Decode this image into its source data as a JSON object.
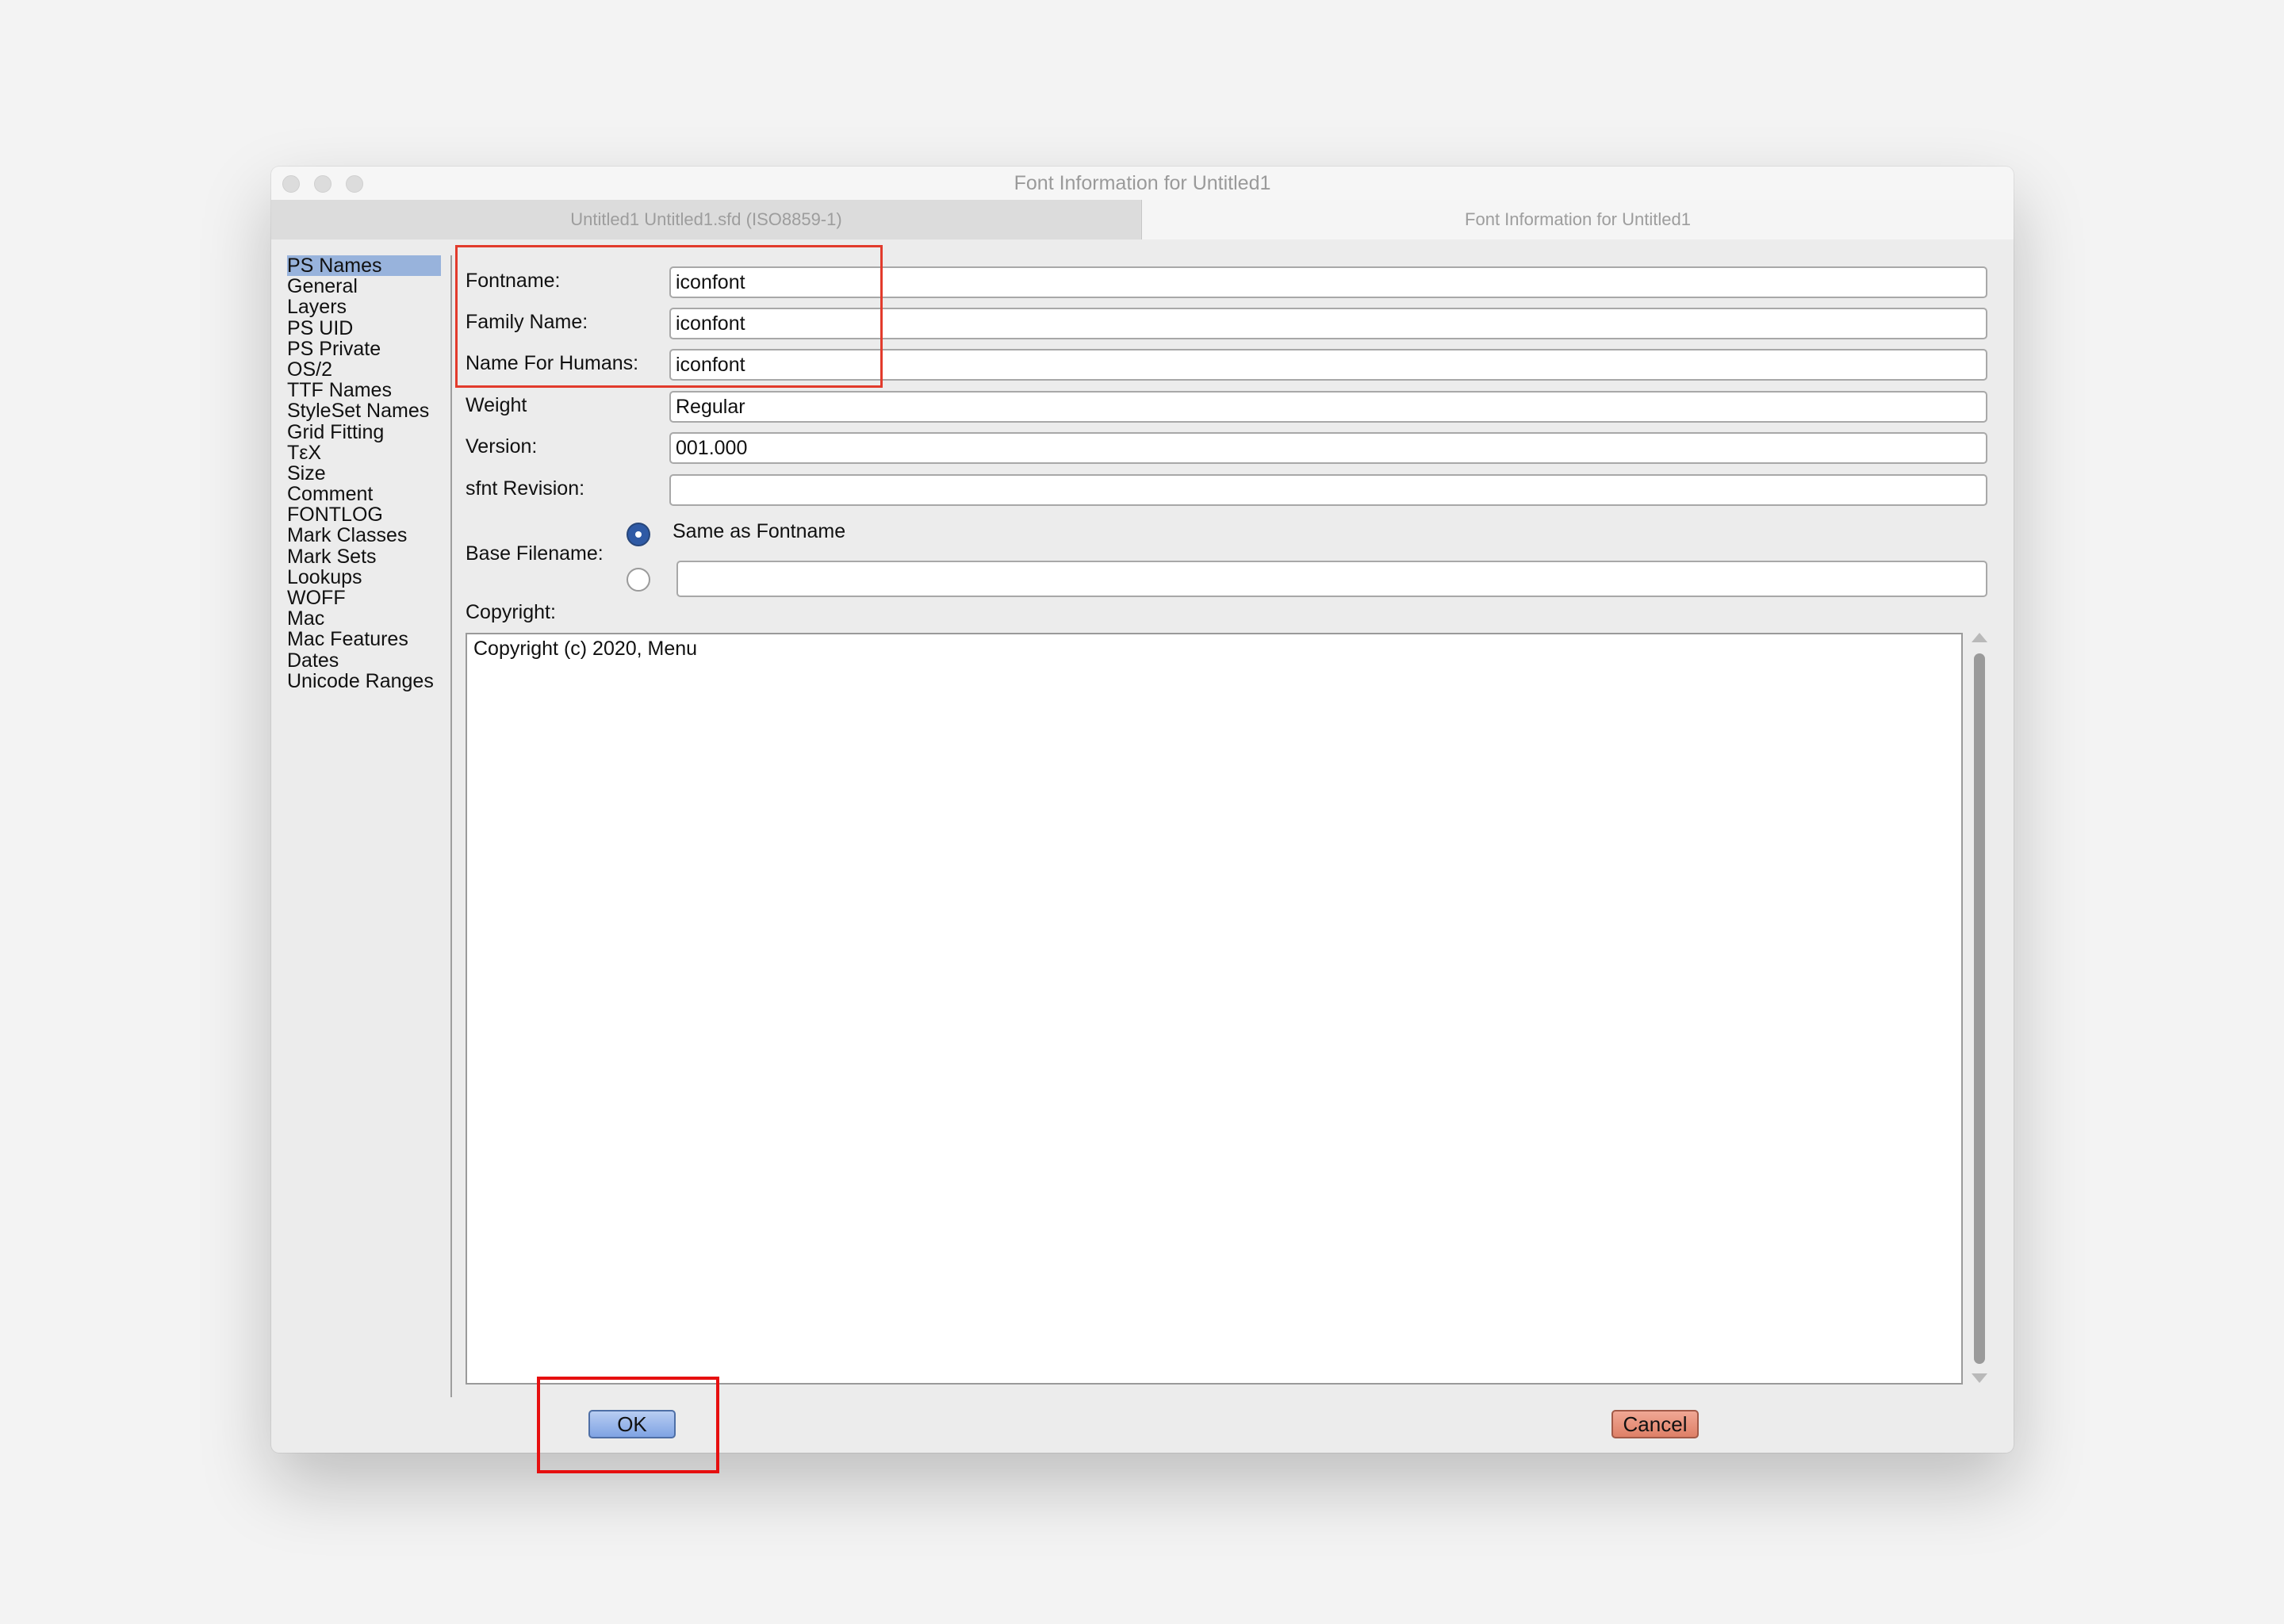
{
  "window": {
    "title": "Font Information for Untitled1"
  },
  "tabs": [
    {
      "label": "Untitled1  Untitled1.sfd (ISO8859-1)"
    },
    {
      "label": "Font Information for Untitled1"
    }
  ],
  "sidebar": {
    "selected": "PS Names",
    "items": [
      "PS Names",
      "General",
      "Layers",
      "PS UID",
      "PS Private",
      "OS/2",
      "TTF Names",
      "StyleSet Names",
      "Grid Fitting",
      "TεX",
      "Size",
      "Comment",
      "FONTLOG",
      "Mark Classes",
      "Mark Sets",
      "Lookups",
      "WOFF",
      "Mac",
      "Mac Features",
      "Dates",
      "Unicode Ranges"
    ]
  },
  "form": {
    "fontname": {
      "label": "Fontname:",
      "value": "iconfont"
    },
    "family_name": {
      "label": "Family Name:",
      "value": "iconfont"
    },
    "name_for_humans": {
      "label": "Name For Humans:",
      "value": "iconfont"
    },
    "weight": {
      "label": "Weight",
      "value": "Regular"
    },
    "version": {
      "label": "Version:",
      "value": "001.000"
    },
    "sfnt_revision": {
      "label": "sfnt Revision:",
      "value": ""
    },
    "base_filename": {
      "label": "Base Filename:",
      "option_same": "Same as Fontname",
      "custom_value": "",
      "selected": "same"
    },
    "copyright": {
      "label": "Copyright:",
      "value": "Copyright (c) 2020, Menu"
    }
  },
  "buttons": {
    "ok": "OK",
    "cancel": "Cancel"
  },
  "colors": {
    "selection": "#98b3dc",
    "ok": "#8fb0e8",
    "cancel": "#e6907a",
    "highlight": "#e23b2c"
  }
}
